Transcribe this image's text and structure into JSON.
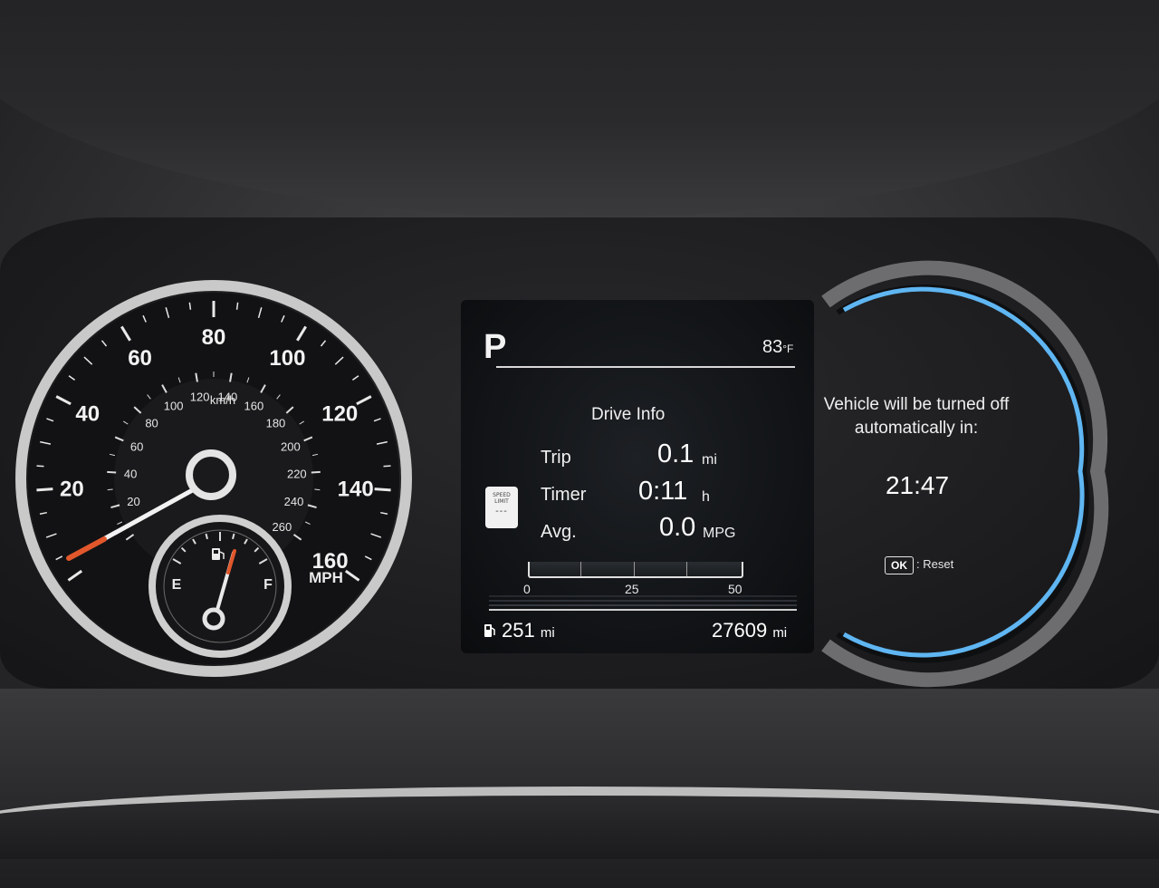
{
  "speedometer": {
    "mph_labels": [
      "20",
      "40",
      "60",
      "80",
      "100",
      "120",
      "140",
      "160"
    ],
    "kmh_labels": [
      "20",
      "40",
      "60",
      "80",
      "100",
      "120",
      "140",
      "160",
      "180",
      "200",
      "220",
      "240",
      "260"
    ],
    "kmh_unit": "km/h",
    "mph_unit": "MPH",
    "needle_mph": 0,
    "accent_color": "#e2572b"
  },
  "fuel_gauge": {
    "empty_label": "E",
    "full_label": "F",
    "level_fraction": 0.55,
    "icon": "fuel-pump-icon"
  },
  "screen": {
    "gear": "P",
    "outside_temp": "83",
    "temp_unit": "°F",
    "drive_info": {
      "title": "Drive Info",
      "rows": [
        {
          "label": "Trip",
          "value": "0.1",
          "unit": "mi"
        },
        {
          "label": "Timer",
          "value": "0:11",
          "unit": "h"
        },
        {
          "label": "Avg.",
          "value": "0.0",
          "unit": "MPG"
        }
      ]
    },
    "speed_limit_sign": {
      "line1": "SPEED",
      "line2": "LIMIT",
      "value": "---"
    },
    "efficiency_bar": {
      "ticks": [
        "0",
        "25",
        "50"
      ],
      "current": 0
    },
    "range": {
      "value": "251",
      "unit": "mi",
      "icon": "fuel-pump-icon"
    },
    "odometer": {
      "value": "27609",
      "unit": "mi"
    }
  },
  "power_panel": {
    "notice": "Vehicle will be turned off automatically in:",
    "countdown": "21:47",
    "ok_button": "OK",
    "ok_action": ": Reset",
    "ring_color": "#5fb6f2"
  }
}
